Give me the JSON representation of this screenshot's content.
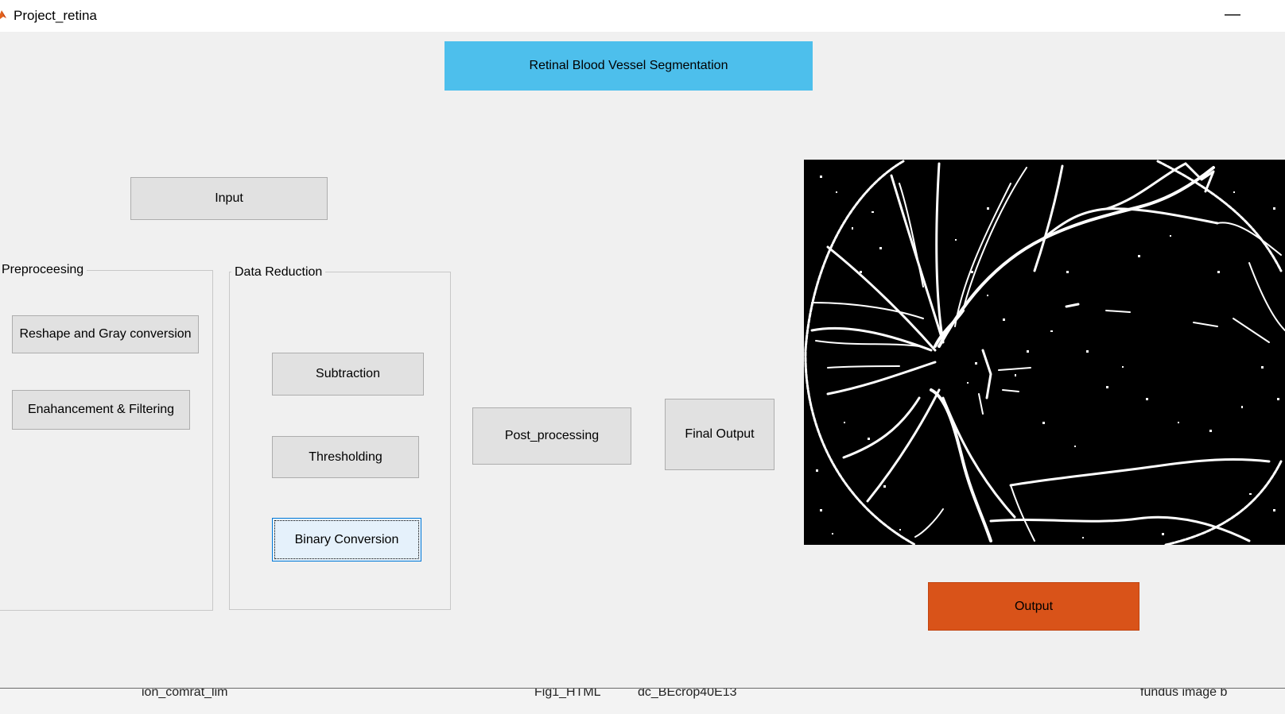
{
  "window": {
    "title": "Project_retina",
    "minimize_label": "—"
  },
  "header_button": {
    "label": "Retinal Blood Vessel Segmentation"
  },
  "input_button": {
    "label": "Input"
  },
  "preprocessing_panel": {
    "title": "Preproceesing",
    "buttons": [
      "Reshape and Gray conversion",
      "Enahancement & Filtering"
    ]
  },
  "data_reduction_panel": {
    "title": "Data  Reduction",
    "buttons": [
      "Subtraction",
      "Thresholding",
      "Binary Conversion"
    ]
  },
  "post_processing_button": {
    "label": "Post_processing"
  },
  "final_output_button": {
    "label": "Final Output"
  },
  "output_button": {
    "label": "Output"
  },
  "footer_items": [
    "ion_comrat_lim",
    "Fig1_HTML",
    "dc_BEcrop40E13",
    "fundus image b"
  ],
  "colors": {
    "header_accent": "#4dbfec",
    "output_accent": "#d95319"
  }
}
